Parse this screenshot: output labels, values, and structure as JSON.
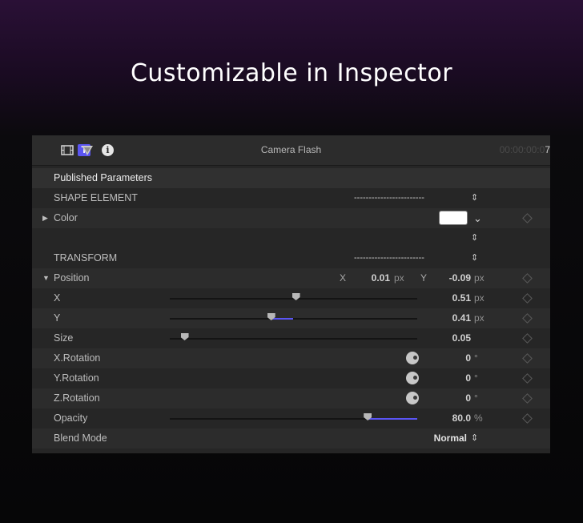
{
  "headline": "Customizable in Inspector",
  "toolbar": {
    "text_tab_glyph": "T",
    "info_glyph": "i",
    "title": "Camera Flash",
    "timecode_dim": "00:00:00:0",
    "timecode_last": "7",
    "icons": [
      "text-inspector-icon",
      "video-inspector-icon",
      "filter-icon",
      "info-icon"
    ],
    "accent_color": "#5b55f2"
  },
  "published_parameters": "Published Parameters",
  "shape_element": {
    "label": "SHAPE ELEMENT",
    "popup_value": "------------------------",
    "popup_chevron": "⇕"
  },
  "color_param": {
    "label": "Color",
    "color_value": "#ffffff",
    "chevron": "⌄",
    "chevron2": "⇕"
  },
  "transform": {
    "label": "TRANSFORM",
    "popup_value": "------------------------",
    "popup_chevron": "⇕"
  },
  "position": {
    "label": "Position",
    "x_label": "X",
    "x_value": "0.01",
    "x_unit": "px",
    "y_label": "Y",
    "y_value": "-0.09",
    "y_unit": "px"
  },
  "params": {
    "x": {
      "label": "X",
      "value": "0.51",
      "unit": "px",
      "slider": 0.51
    },
    "y": {
      "label": "Y",
      "value": "0.41",
      "unit": "px",
      "slider": 0.41
    },
    "size": {
      "label": "Size",
      "value": "0.05",
      "slider": 0.06
    },
    "x_rotation": {
      "label": "X.Rotation",
      "value": "0",
      "unit": "°"
    },
    "y_rotation": {
      "label": "Y.Rotation",
      "value": "0",
      "unit": "°"
    },
    "z_rotation": {
      "label": "Z.Rotation",
      "value": "0",
      "unit": "°"
    },
    "opacity": {
      "label": "Opacity",
      "value": "80.0",
      "unit": "%",
      "slider": 0.8
    },
    "blend_mode": {
      "label": "Blend Mode",
      "value": "Normal",
      "chevron": "⇕"
    }
  },
  "glyphs": {
    "disclosure_closed": "▶",
    "disclosure_open": "▼"
  }
}
